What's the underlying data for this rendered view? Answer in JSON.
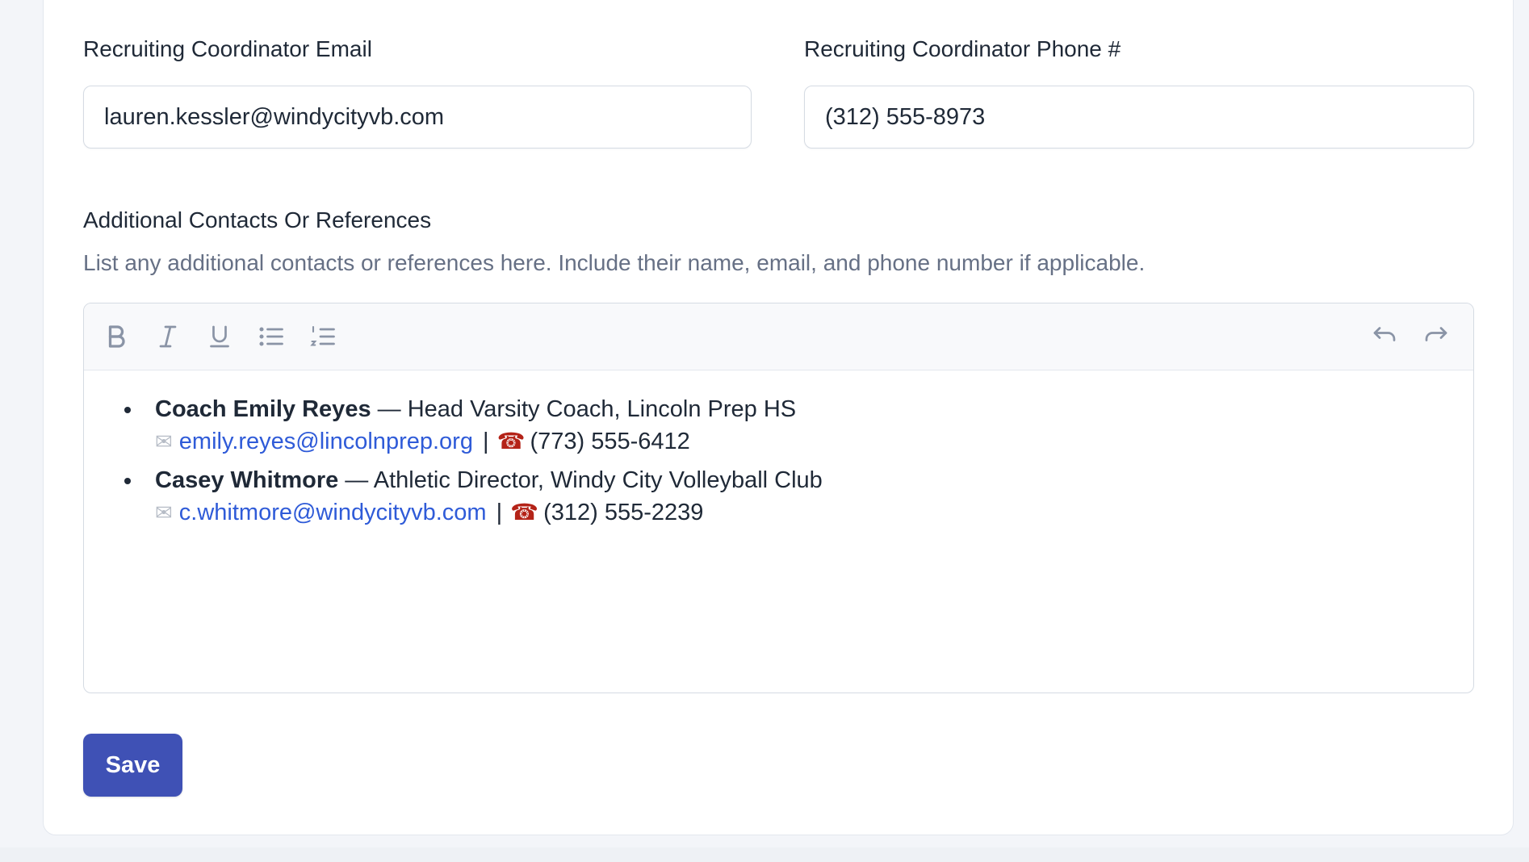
{
  "recruiting": {
    "email_label": "Recruiting Coordinator Email",
    "email_value": "lauren.kessler@windycityvb.com",
    "phone_label": "Recruiting Coordinator Phone #",
    "phone_value": "(312) 555-8973"
  },
  "additional": {
    "label": "Additional Contacts Or References",
    "description": "List any additional contacts or references here. Include their name, email, and phone number if applicable.",
    "toolbar": {
      "buttons": [
        "bold-icon",
        "italic-icon",
        "underline-icon",
        "bullet-list-icon",
        "numbered-list-icon",
        "undo-icon",
        "redo-icon"
      ]
    },
    "contacts": [
      {
        "name": "Coach Emily Reyes",
        "role": "— Head Varsity Coach, Lincoln Prep HS",
        "email": "emily.reyes@lincolnprep.org",
        "separator": "|",
        "phone": "(773) 555-6412"
      },
      {
        "name": "Casey Whitmore",
        "role": "— Athletic Director, Windy City Volleyball Club",
        "email": "c.whitmore@windycityvb.com",
        "separator": "|",
        "phone": "(312) 555-2239"
      }
    ]
  },
  "actions": {
    "save_label": "Save"
  },
  "colors": {
    "primary": "#3f51b5",
    "link": "#2f5bd8",
    "muted": "#667085"
  }
}
